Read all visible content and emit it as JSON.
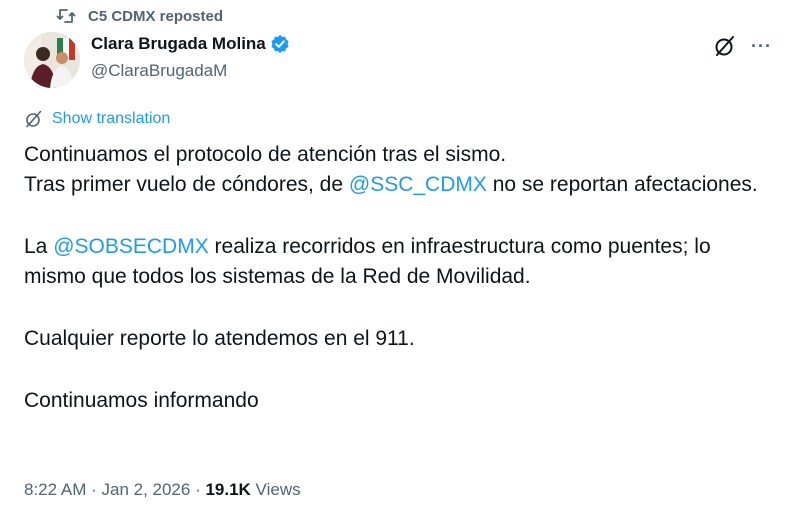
{
  "repost": {
    "label": "C5 CDMX reposted"
  },
  "author": {
    "name": "Clara Brugada Molina",
    "handle": "@ClaraBrugadaM"
  },
  "actions": {
    "more": "···"
  },
  "translate": {
    "label": "Show translation"
  },
  "tweet": {
    "p1_line1": "Continuamos el protocolo de atención tras el sismo.",
    "p1_line2_a": "Tras primer vuelo de cóndores, de ",
    "p1_mention": "@SSC_CDMX",
    "p1_line2_b": " no se reportan afectaciones.",
    "p2_a": "La ",
    "p2_mention": "@SOBSECDMX",
    "p2_b": " realiza recorridos en infraestructura como puentes; lo mismo que todos los sistemas de la Red de Movilidad.",
    "p3": "Cualquier reporte lo atendemos en el 911.",
    "p4": "Continuamos informando"
  },
  "meta": {
    "time": "8:22 AM",
    "sep1": " · ",
    "date": "Jan 2, 2026",
    "sep2": " · ",
    "views_count": "19.1K",
    "views_label": " Views"
  },
  "colors": {
    "accent": "#1d9bf0",
    "muted": "#536471",
    "text": "#0f1419"
  },
  "icons": {
    "repost": "repost-icon",
    "verified": "verified-badge-icon",
    "grok": "grok-icon",
    "translate": "translate-icon"
  }
}
